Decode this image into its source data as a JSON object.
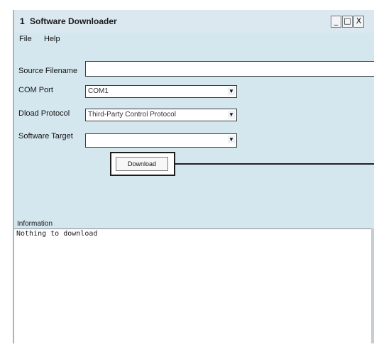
{
  "window": {
    "icon_glyph": "1",
    "title": "Software Downloader",
    "minimize_glyph": "_",
    "maximize_glyph": "□",
    "close_glyph": "X"
  },
  "menu": {
    "file": "File",
    "help": "Help"
  },
  "form": {
    "source_filename": {
      "label": "Source Filename",
      "value": ""
    },
    "com_port": {
      "label": "COM Port",
      "value": "COM1"
    },
    "dload_protocol": {
      "label": "Dload Protocol",
      "value": "Third-Party Control Protocol"
    },
    "software_target": {
      "label": "Software Target",
      "value": ""
    },
    "select_arrow_glyph": "▼"
  },
  "download_button": {
    "label": "Download"
  },
  "information": {
    "label": "Information",
    "text": "Nothing to download"
  },
  "colors": {
    "window_background": "#d4e6ee",
    "field_background": "#ffffff",
    "callout_line": "#222222"
  }
}
